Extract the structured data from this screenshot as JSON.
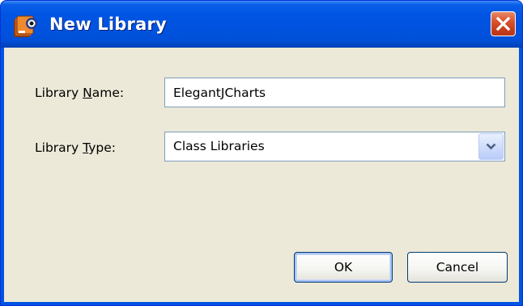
{
  "window": {
    "title": "New Library",
    "app_icon": "library-books-icon",
    "close_icon": "close-x-icon"
  },
  "form": {
    "library_name": {
      "label_before": "Library ",
      "label_mnemonic": "N",
      "label_after": "ame:",
      "value": "ElegantJCharts"
    },
    "library_type": {
      "label_before": "Library ",
      "label_mnemonic": "T",
      "label_after": "ype:",
      "selected": "Class Libraries",
      "arrow_icon": "chevron-down-icon"
    }
  },
  "buttons": {
    "ok_label": "OK",
    "cancel_label": "Cancel"
  },
  "colors": {
    "titlebar": "#0054e3",
    "dialog_background": "#ece9d8",
    "close_button": "#d8532d",
    "input_border": "#7f9db9"
  }
}
